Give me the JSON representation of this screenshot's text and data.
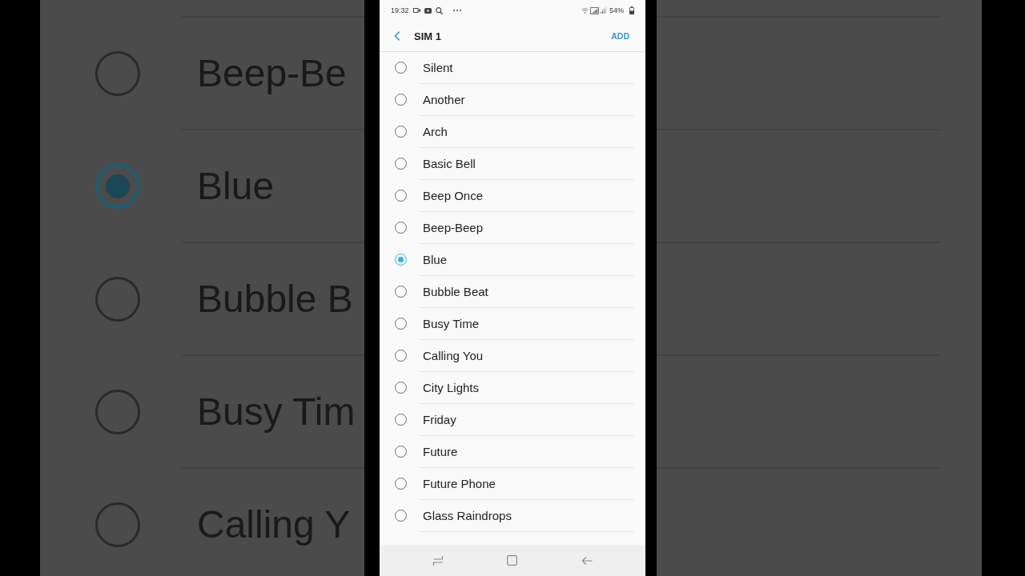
{
  "backdrop": {
    "items": [
      {
        "label": "Beep-Be",
        "selected": false
      },
      {
        "label": "Blue",
        "selected": true
      },
      {
        "label": "Bubble B",
        "selected": false
      },
      {
        "label": "Busy Tim",
        "selected": false
      },
      {
        "label": "Calling Y",
        "selected": false
      }
    ]
  },
  "status_bar": {
    "time": "19:32",
    "battery": "54%"
  },
  "header": {
    "title": "SIM 1",
    "action": "ADD"
  },
  "ringtones": [
    {
      "label": "Silent",
      "selected": false
    },
    {
      "label": "Another",
      "selected": false
    },
    {
      "label": "Arch",
      "selected": false
    },
    {
      "label": "Basic Bell",
      "selected": false
    },
    {
      "label": "Beep Once",
      "selected": false
    },
    {
      "label": "Beep-Beep",
      "selected": false
    },
    {
      "label": "Blue",
      "selected": true
    },
    {
      "label": "Bubble Beat",
      "selected": false
    },
    {
      "label": "Busy Time",
      "selected": false
    },
    {
      "label": "Calling You",
      "selected": false
    },
    {
      "label": "City Lights",
      "selected": false
    },
    {
      "label": "Friday",
      "selected": false
    },
    {
      "label": "Future",
      "selected": false
    },
    {
      "label": "Future Phone",
      "selected": false
    },
    {
      "label": "Glass Raindrops",
      "selected": false
    }
  ]
}
